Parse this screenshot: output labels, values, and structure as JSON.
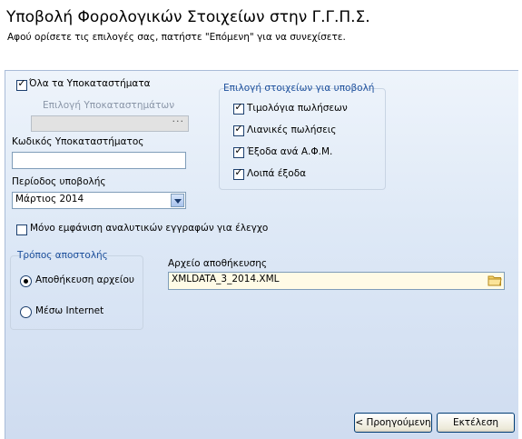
{
  "header": {
    "title": "Υποβολή Φορολογικών Στοιχείων στην Γ.Γ.Π.Σ.",
    "subtitle": "Αφού ορίσετε τις επιλογές σας, πατήστε \"Επόμενη\" για να συνεχίσετε."
  },
  "form": {
    "all_branches": {
      "label": "Όλα τα Υποκαταστήματα",
      "checked": true
    },
    "branch_selection": {
      "label": "Επιλογή Υποκαταστημάτων",
      "value": "",
      "button_text": "···"
    },
    "branch_code": {
      "label": "Κωδικός Υποκαταστήματος",
      "value": ""
    },
    "period": {
      "label": "Περίοδος υποβολής",
      "value": "Μάρτιος 2014"
    },
    "analytic_only": {
      "label": "Μόνο εμφάνιση αναλυτικών εγγραφών για έλεγχο",
      "checked": false
    }
  },
  "data_selection": {
    "title": "Επιλογή στοιχείων για υποβολή",
    "items": [
      {
        "label": "Τιμολόγια πωλήσεων",
        "checked": true
      },
      {
        "label": "Λιανικές πωλήσεις",
        "checked": true
      },
      {
        "label": "Έξοδα ανά Α.Φ.Μ.",
        "checked": true
      },
      {
        "label": "Λοιπά έξοδα",
        "checked": true
      }
    ]
  },
  "send_method": {
    "title": "Τρόπος αποστολής",
    "options": [
      {
        "label": "Αποθήκευση αρχείου",
        "selected": true
      },
      {
        "label": "Μέσω Internet",
        "selected": false
      }
    ]
  },
  "save_file": {
    "label": "Αρχείο αποθήκευσης",
    "value": "XMLDATA_3_2014.XML"
  },
  "buttons": {
    "back": "< Προηγούμενη",
    "execute": "Εκτέλεση"
  },
  "colors": {
    "group_title": "#1c4f9c",
    "panel_top": "#eef4fb",
    "panel_bottom": "#cfdcf0",
    "file_field_bg": "#fffbe6"
  }
}
